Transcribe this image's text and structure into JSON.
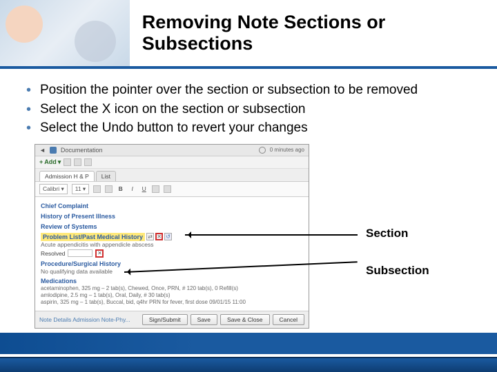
{
  "title": "Removing Note Sections or Subsections",
  "bullets": [
    "Position the pointer over the section or subsection to be removed",
    "Select the X icon on the section or subsection",
    "Select the Undo button to revert your changes"
  ],
  "labels": {
    "section": "Section",
    "subsection": "Subsection"
  },
  "shot": {
    "topTitle": "Documentation",
    "minutes": "0 minutes ago",
    "add": "Add",
    "tab1": "Admission H & P",
    "tab2": "List",
    "font": "Calibri",
    "size": "11",
    "B": "B",
    "I": "I",
    "U": "U",
    "sec1": "Chief Complaint",
    "sec2": "History of Present Illness",
    "sec3": "Review of Systems",
    "sec4": "Problem List/Past Medical History",
    "sec4line": "Acute appendicitis with appendicle abscess",
    "subLabel": "Resolved",
    "sec5": "Procedure/Surgical History",
    "sec5line": "No qualifying data available",
    "sec6": "Medications",
    "med1": "acetaminophen, 325 mg – 2 tab(s), Chewed, Once, PRN, # 120 tab(s), 0 Refill(s)",
    "med2": "amlodipine, 2.5 mg – 1 tab(s), Oral, Daily, # 30 tab(s)",
    "med3": "aspirin, 325 mg – 1 tab(s), Buccal, bid, q4hr PRN for fever, first dose 09/01/15 11:00",
    "noteDetails": "Note Details Admission Note-Phy...",
    "btnSign": "Sign/Submit",
    "btnSave": "Save",
    "btnSaveClose": "Save & Close",
    "btnCancel": "Cancel"
  }
}
